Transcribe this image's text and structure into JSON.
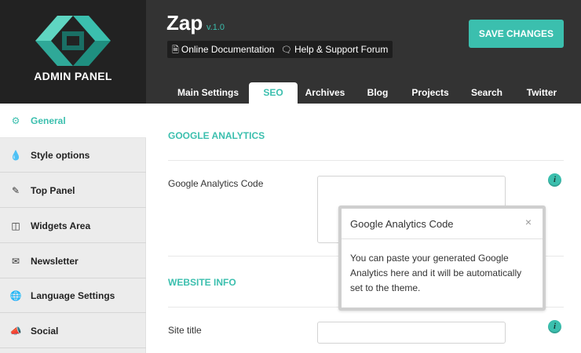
{
  "colors": {
    "accent": "#3bbfae",
    "header_bg": "#333333",
    "logo_bg": "#222222",
    "sidebar_bg": "#ececec"
  },
  "brand": {
    "label": "ADMIN PANEL",
    "logo_icon": "geometric-logo-icon"
  },
  "app": {
    "title": "Zap",
    "version": "v.1.0"
  },
  "header": {
    "doc_button": {
      "label": "Online Documentation",
      "icon": "document-icon"
    },
    "help_button": {
      "label": "Help & Support Forum",
      "icon": "chat-icon"
    },
    "save_label": "SAVE CHANGES"
  },
  "tabs": [
    {
      "label": "Main Settings"
    },
    {
      "label": "SEO",
      "active": true
    },
    {
      "label": "Archives"
    },
    {
      "label": "Blog"
    },
    {
      "label": "Projects"
    },
    {
      "label": "Search"
    },
    {
      "label": "Twitter"
    }
  ],
  "sidebar": {
    "items": [
      {
        "label": "General",
        "icon": "gears-icon",
        "active": true
      },
      {
        "label": "Style options",
        "icon": "drop-icon"
      },
      {
        "label": "Top Panel",
        "icon": "edit-icon"
      },
      {
        "label": "Widgets Area",
        "icon": "columns-icon"
      },
      {
        "label": "Newsletter",
        "icon": "envelope-icon"
      },
      {
        "label": "Language Settings",
        "icon": "globe-icon"
      },
      {
        "label": "Social",
        "icon": "megaphone-icon"
      }
    ]
  },
  "main": {
    "analytics_section": {
      "title": "GOOGLE ANALYTICS",
      "field_label": "Google Analytics Code",
      "field_value": ""
    },
    "website_section": {
      "title": "WEBSITE INFO",
      "site_title_label": "Site title",
      "site_title_value": ""
    }
  },
  "tooltip": {
    "title": "Google Analytics Code",
    "close": "×",
    "body": "You can paste your generated Google Analytics here and it will be automatically set to the theme."
  }
}
